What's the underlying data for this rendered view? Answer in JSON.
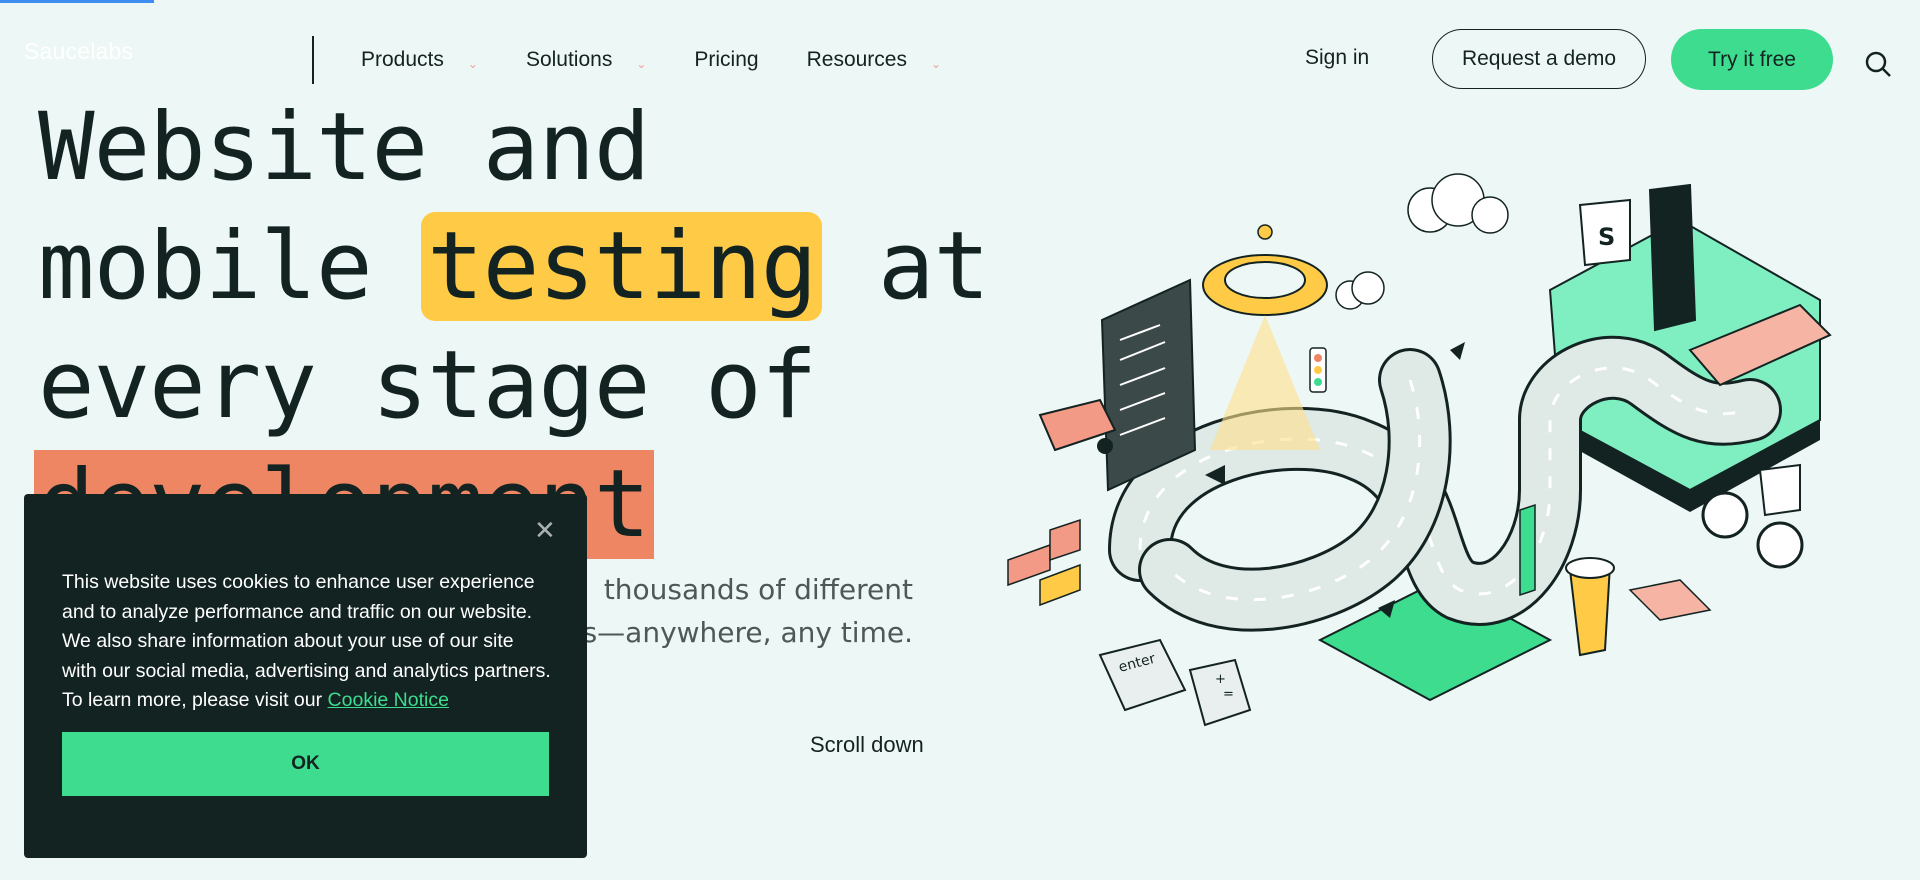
{
  "brand": {
    "logo_text": "Saucelabs"
  },
  "nav": {
    "items": [
      {
        "label": "Products",
        "has_dropdown": true
      },
      {
        "label": "Solutions",
        "has_dropdown": true
      },
      {
        "label": "Pricing",
        "has_dropdown": false
      },
      {
        "label": "Resources",
        "has_dropdown": true
      }
    ],
    "sign_in": "Sign in",
    "request_demo": "Request a demo",
    "try_free": "Try it free",
    "search_icon": "search-icon"
  },
  "hero": {
    "line1": "Website and",
    "line2_pre": "mobile ",
    "line2_hl": "testing",
    "line2_post": " at",
    "line3": "every stage of",
    "line4": "development",
    "sub_line1": "thousands of different",
    "sub_line2": "s—anywhere, any time."
  },
  "scroll_down": "Scroll down",
  "cookie": {
    "text": "This website uses cookies to enhance user experience and to analyze performance and traffic on our website. We also share information about your use of our site with our social media, advertising and analytics partners. To learn more, please visit our",
    "link": "Cookie Notice",
    "ok": "OK",
    "close_icon": "close-icon"
  },
  "illustration": {
    "keycap_enter": "enter",
    "keycap_plus": "+",
    "keycap_equals": "="
  },
  "colors": {
    "background": "#edf7f5",
    "dark": "#132322",
    "accent_green": "#3ddc8f",
    "highlight_yellow": "#ffcb47",
    "highlight_orange": "#ef8663",
    "progress_blue": "#3d8ef0"
  }
}
